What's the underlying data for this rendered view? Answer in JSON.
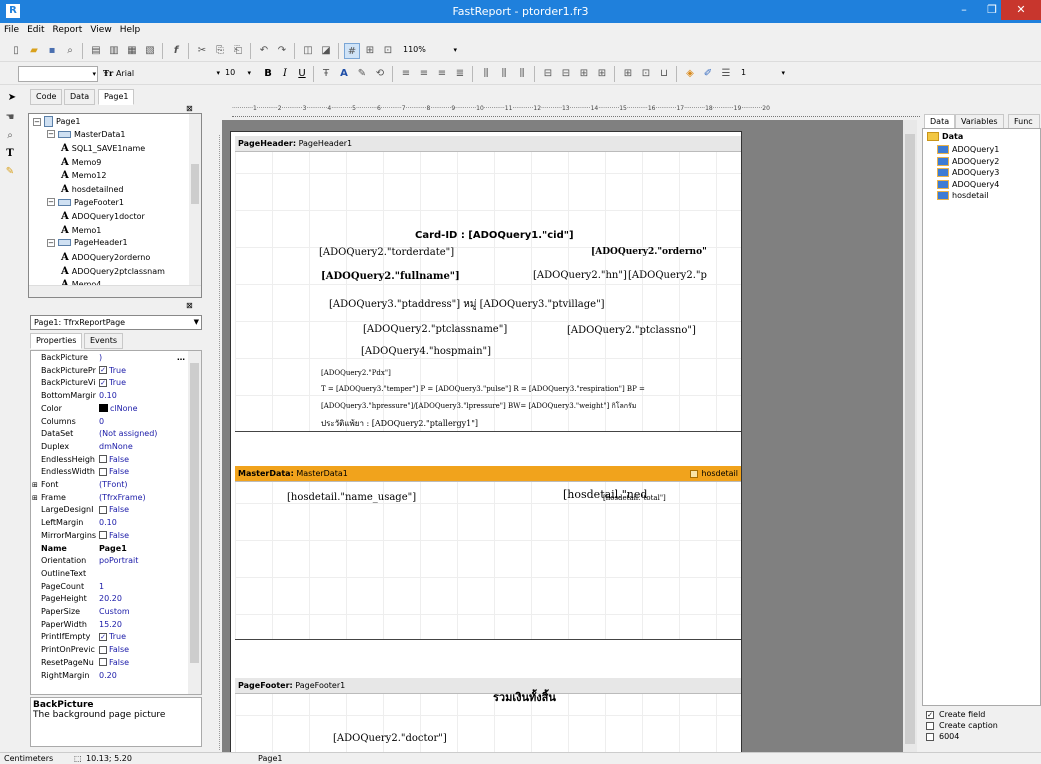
{
  "window": {
    "title": "FastReport - ptorder1.fr3",
    "app_icon": "R",
    "minimize": "–",
    "maximize": "❐",
    "close": "✕"
  },
  "menu": [
    "File",
    "Edit",
    "Report",
    "View",
    "Help"
  ],
  "toolbar": {
    "zoom": "110%",
    "font_name": "Arial",
    "font_size": "10",
    "bold": "B",
    "italic": "I",
    "underline": "U",
    "frame_width": "1"
  },
  "design_tabs": [
    "Code",
    "Data",
    "Page1"
  ],
  "tree": {
    "items": [
      {
        "label": "Page1",
        "level": 0,
        "type": "page"
      },
      {
        "label": "MasterData1",
        "level": 1,
        "type": "band"
      },
      {
        "label": "SQL1_SAVE1name",
        "level": 2,
        "type": "memo"
      },
      {
        "label": "Memo9",
        "level": 2,
        "type": "memo"
      },
      {
        "label": "Memo12",
        "level": 2,
        "type": "memo"
      },
      {
        "label": "hosdetailned",
        "level": 2,
        "type": "memo"
      },
      {
        "label": "PageFooter1",
        "level": 1,
        "type": "band"
      },
      {
        "label": "ADOQuery1doctor",
        "level": 2,
        "type": "memo"
      },
      {
        "label": "Memo1",
        "level": 2,
        "type": "memo"
      },
      {
        "label": "PageHeader1",
        "level": 1,
        "type": "band"
      },
      {
        "label": "ADOQuery2orderno",
        "level": 2,
        "type": "memo"
      },
      {
        "label": "ADOQuery2ptclassnam",
        "level": 2,
        "type": "memo"
      },
      {
        "label": "Memo4",
        "level": 2,
        "type": "memo"
      }
    ]
  },
  "object_selector": "Page1: TfrxReportPage",
  "prop_tabs": [
    "Properties",
    "Events"
  ],
  "properties": [
    {
      "name": "BackPicture",
      "value": ")",
      "kind": "text"
    },
    {
      "name": "BackPicturePr",
      "value": "True",
      "kind": "check"
    },
    {
      "name": "BackPictureVi",
      "value": "True",
      "kind": "check"
    },
    {
      "name": "BottomMargir",
      "value": "0.10",
      "kind": "text"
    },
    {
      "name": "Color",
      "value": "clNone",
      "kind": "color"
    },
    {
      "name": "Columns",
      "value": "0",
      "kind": "text"
    },
    {
      "name": "DataSet",
      "value": "(Not assigned)",
      "kind": "text"
    },
    {
      "name": "Duplex",
      "value": "dmNone",
      "kind": "text"
    },
    {
      "name": "EndlessHeigh",
      "value": "False",
      "kind": "uncheck"
    },
    {
      "name": "EndlessWidth",
      "value": "False",
      "kind": "uncheck"
    },
    {
      "name": "Font",
      "value": "(TFont)",
      "kind": "group"
    },
    {
      "name": "Frame",
      "value": "(TfrxFrame)",
      "kind": "group"
    },
    {
      "name": "LargeDesignI",
      "value": "False",
      "kind": "uncheck"
    },
    {
      "name": "LeftMargin",
      "value": "0.10",
      "kind": "text"
    },
    {
      "name": "MirrorMargins",
      "value": "False",
      "kind": "uncheck"
    },
    {
      "name": "Name",
      "value": "Page1",
      "kind": "bold"
    },
    {
      "name": "Orientation",
      "value": "poPortrait",
      "kind": "text"
    },
    {
      "name": "OutlineText",
      "value": "",
      "kind": "text"
    },
    {
      "name": "PageCount",
      "value": "1",
      "kind": "text"
    },
    {
      "name": "PageHeight",
      "value": "20.20",
      "kind": "text"
    },
    {
      "name": "PaperSize",
      "value": "Custom",
      "kind": "text"
    },
    {
      "name": "PaperWidth",
      "value": "15.20",
      "kind": "text"
    },
    {
      "name": "PrintIfEmpty",
      "value": "True",
      "kind": "check"
    },
    {
      "name": "PrintOnPrevic",
      "value": "False",
      "kind": "uncheck"
    },
    {
      "name": "ResetPageNu",
      "value": "False",
      "kind": "uncheck"
    },
    {
      "name": "RightMargin",
      "value": "0.20",
      "kind": "text"
    }
  ],
  "prop_desc": {
    "title": "BackPicture",
    "text": "The background page picture"
  },
  "bands": {
    "header": {
      "kind": "PageHeader:",
      "name": "PageHeader1"
    },
    "master": {
      "kind": "MasterData:",
      "name": "MasterData1",
      "dataset": "hosdetail"
    },
    "footer": {
      "kind": "PageFooter:",
      "name": "PageFooter1"
    }
  },
  "memos": {
    "cid": "Card-ID : [ADOQuery1.\"cid\"]",
    "orderdate": "[ADOQuery2.\"torderdate\"]",
    "orderno": "[ADOQuery2.\"orderno\"",
    "fullname": "[ADOQuery2.\"fullname\"]",
    "hn": "[ADOQuery2.\"hn\"]",
    "p": "[ADOQuery2.\"p",
    "address": "[ADOQuery3.\"ptaddress\"] หมู่ [ADOQuery3.\"ptvillage\"]",
    "ptclassname": "[ADOQuery2.\"ptclassname\"]",
    "ptclassno": "[ADOQuery2.\"ptclassno\"]",
    "hospmain": "[ADOQuery4.\"hospmain\"]",
    "pdx": "[ADOQuery2.\"Pdx\"]",
    "vitals": "T = [ADOQuery3.\"temper\"] P = [ADOQuery3.\"pulse\"] R = [ADOQuery3.\"respiration\"]  BP =",
    "bp": "[ADOQuery3.\"hpressure\"]/[ADOQuery3.\"lpressure\"]  BW= [ADOQuery3.\"weight\"] กิโลกรัม",
    "allergy": "ประวัติแพ้ยา : [ADOQuery2.\"ptallergy1\"]",
    "name_usage": "[hosdetail.\"name_usage\"]",
    "hosdetail_ned": "[hosdetail.\"ned",
    "hosdetail_total": "[hosdetail.\"total\"]",
    "total_label": "รวมเงินทั้งสิ้น",
    "doctor": "[ADOQuery2.\"doctor\"]"
  },
  "data_panel": {
    "tabs": [
      "Data",
      "Variables",
      "Func"
    ],
    "root": "Data",
    "items": [
      "ADOQuery1",
      "ADOQuery2",
      "ADOQuery3",
      "ADOQuery4",
      "hosdetail"
    ],
    "options": [
      {
        "label": "Create field",
        "checked": true
      },
      {
        "label": "Create caption",
        "checked": false
      },
      {
        "label": "6004",
        "checked": false
      }
    ]
  },
  "status": {
    "units": "Centimeters",
    "position": "10.13; 5.20",
    "page": "Page1"
  }
}
